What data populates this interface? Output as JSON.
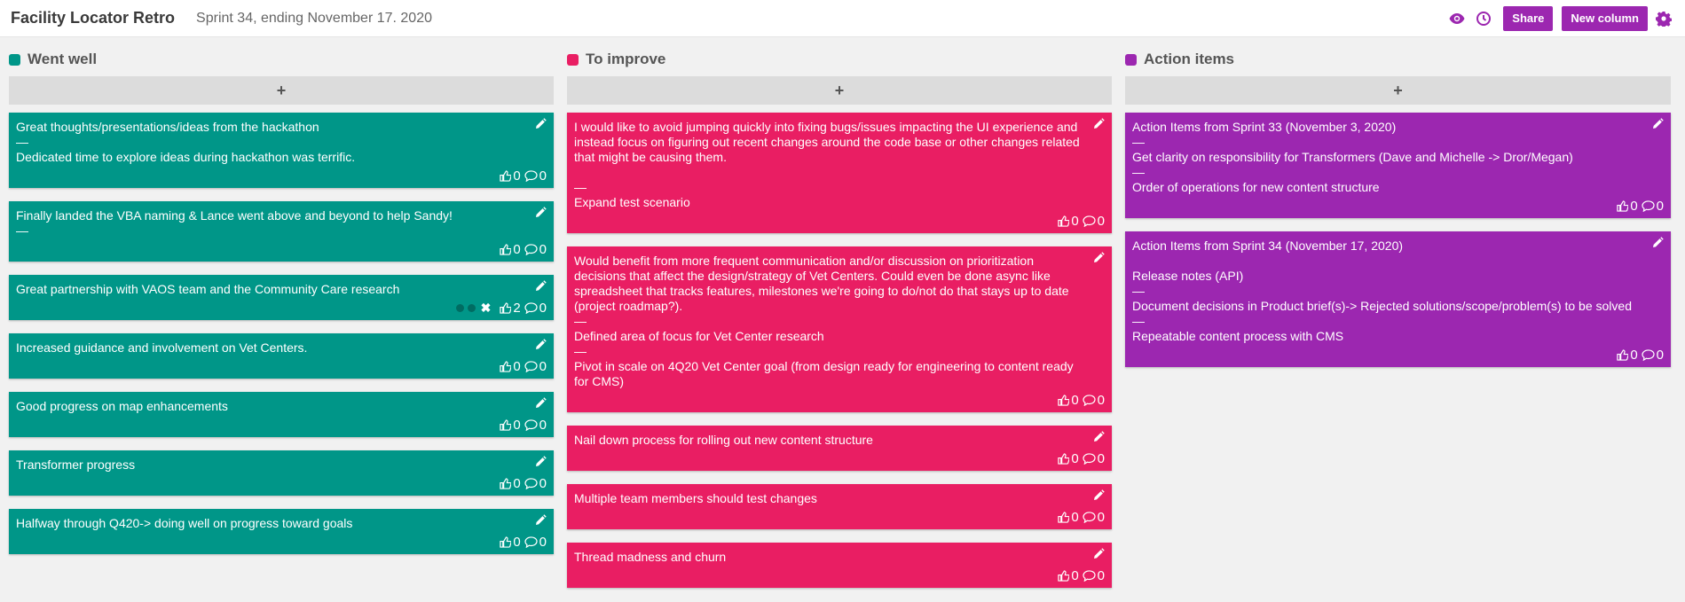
{
  "header": {
    "title": "Facility Locator Retro",
    "subtitle": "Sprint 34, ending November 17. 2020",
    "share_label": "Share",
    "new_column_label": "New column"
  },
  "colors": {
    "went_well": "#009688",
    "to_improve": "#e91e63",
    "action_items": "#9c27b0"
  },
  "columns": [
    {
      "title": "Went well",
      "add_label": "+",
      "color": "#009688",
      "cards": [
        {
          "lines": [
            "Great thoughts/presentations/ideas from the hackathon",
            "—",
            "Dedicated time to explore ideas during hackathon was terrific."
          ],
          "likes": "0",
          "comments": "0"
        },
        {
          "lines": [
            "Finally landed the VBA naming & Lance went above and beyond to help Sandy!",
            "—"
          ],
          "likes": "0",
          "comments": "0"
        },
        {
          "lines": [
            "Great partnership with VAOS team and the Community Care research"
          ],
          "likes": "2",
          "comments": "0",
          "voting": true
        },
        {
          "lines": [
            "Increased guidance and involvement on Vet Centers."
          ],
          "likes": "0",
          "comments": "0"
        },
        {
          "lines": [
            "Good progress on map enhancements"
          ],
          "likes": "0",
          "comments": "0"
        },
        {
          "lines": [
            "Transformer progress"
          ],
          "likes": "0",
          "comments": "0"
        },
        {
          "lines": [
            "Halfway through Q420-> doing well on progress toward goals"
          ],
          "likes": "0",
          "comments": "0"
        }
      ]
    },
    {
      "title": "To improve",
      "add_label": "+",
      "color": "#e91e63",
      "cards": [
        {
          "lines": [
            "I would like to avoid jumping quickly into fixing bugs/issues impacting the UI experience and instead focus on figuring out recent changes around the code base or other changes related that might be causing them.",
            "",
            "—",
            "Expand test scenario"
          ],
          "likes": "0",
          "comments": "0"
        },
        {
          "lines": [
            "Would benefit from more frequent communication and/or discussion on prioritization decisions that affect the design/strategy of Vet Centers. Could even be done async like spreadsheet that tracks features, milestones we're going to do/not do that stays up to date (project roadmap?).",
            "—",
            "Defined area of focus for Vet Center research",
            "—",
            "Pivot in scale on 4Q20 Vet Center goal (from design ready for engineering to content ready for CMS)"
          ],
          "likes": "0",
          "comments": "0"
        },
        {
          "lines": [
            "Nail down process for rolling out new content structure"
          ],
          "likes": "0",
          "comments": "0"
        },
        {
          "lines": [
            "Multiple team members should test changes"
          ],
          "likes": "0",
          "comments": "0"
        },
        {
          "lines": [
            "Thread madness and churn"
          ],
          "likes": "0",
          "comments": "0"
        }
      ]
    },
    {
      "title": "Action items",
      "add_label": "+",
      "color": "#9c27b0",
      "cards": [
        {
          "lines": [
            "Action Items from Sprint 33 (November 3, 2020)",
            "—",
            "Get clarity on responsibility for Transformers (Dave and Michelle -> Dror/Megan)",
            "—",
            "Order of operations for new content structure"
          ],
          "likes": "0",
          "comments": "0"
        },
        {
          "lines": [
            "Action Items from Sprint 34 (November 17, 2020)",
            "",
            "Release notes (API)",
            "—",
            "Document decisions in Product brief(s)-> Rejected solutions/scope/problem(s) to be solved",
            "—",
            "Repeatable content process with CMS"
          ],
          "likes": "0",
          "comments": "0"
        }
      ]
    }
  ]
}
